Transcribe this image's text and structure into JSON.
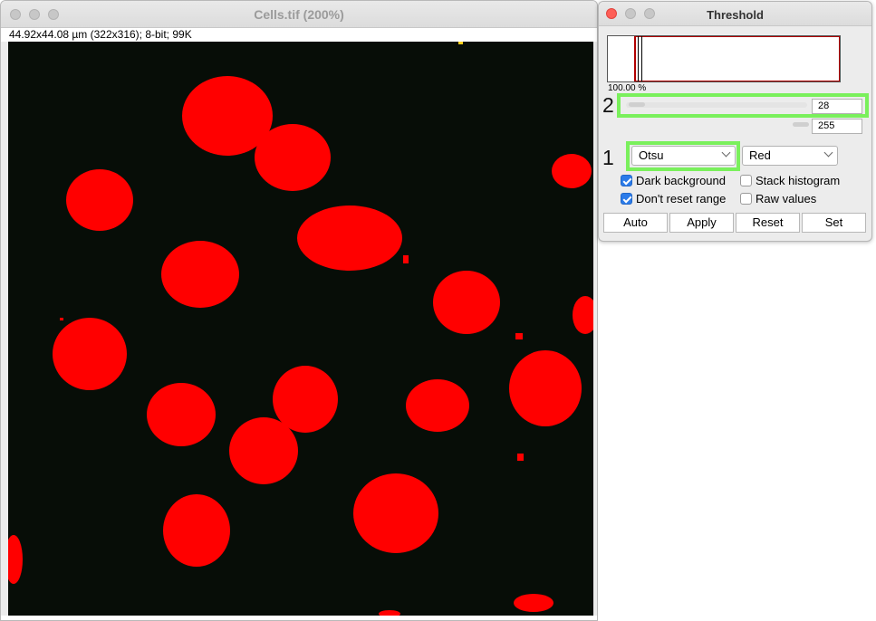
{
  "image_window": {
    "title": "Cells.tif (200%)",
    "info": "44.92x44.08 µm (322x316); 8-bit; 99K"
  },
  "threshold_window": {
    "title": "Threshold",
    "histogram_percent": "100.00 %",
    "step1_label": "1",
    "step2_label": "2",
    "min_value": "28",
    "max_value": "255",
    "method_select": "Otsu",
    "display_select": "Red",
    "checkboxes": {
      "dark_background": {
        "label": "Dark background",
        "checked": true
      },
      "stack_histogram": {
        "label": "Stack histogram",
        "checked": false
      },
      "dont_reset_range": {
        "label": "Don't reset range",
        "checked": true
      },
      "raw_values": {
        "label": "Raw values",
        "checked": false
      }
    },
    "buttons": {
      "auto": "Auto",
      "apply": "Apply",
      "reset": "Reset",
      "set": "Set"
    }
  },
  "colors": {
    "threshold_overlay": "#ff0000",
    "background": "#070d07",
    "highlight": "#7af05c"
  }
}
